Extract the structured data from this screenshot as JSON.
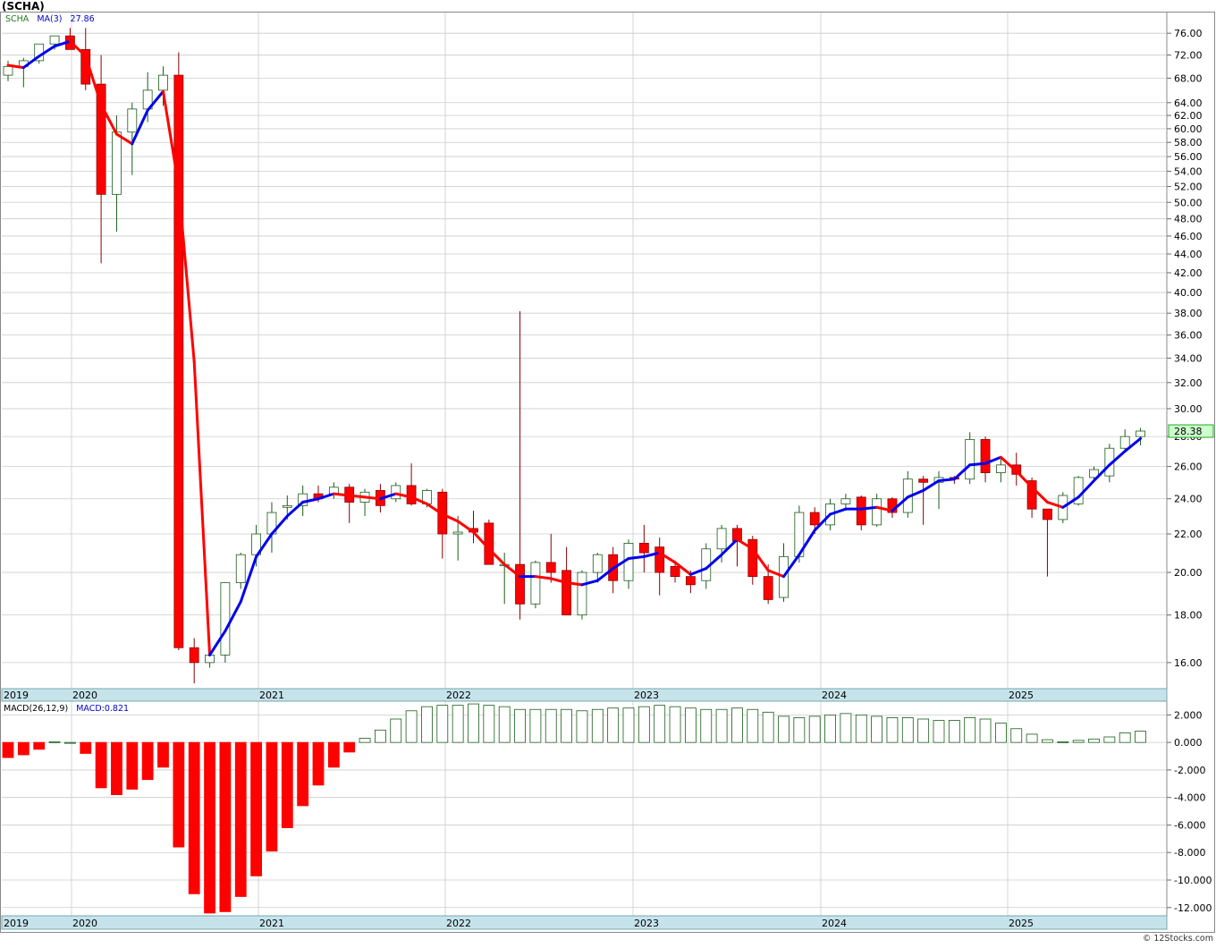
{
  "window": {
    "title": "(SCHA)",
    "footer": "© 12Stocks.com"
  },
  "legend": {
    "symbol": "SCHA",
    "ma_label": "MA(3)",
    "ma_value": "27.86",
    "macd_label": "MACD(26,12,9)",
    "macd_value": "MACD:0.821",
    "last_price": "28.38"
  },
  "colors": {
    "up_candle_fill": "#ffffff",
    "up_candle_border": "#1a5c1a",
    "down_candle": "#ff0000",
    "ma_up": "#0000ee",
    "ma_down": "#ff0000",
    "macd_pos": "#1a5c1a",
    "macd_neg": "#ff0000",
    "axis_band": "#c6e3ec",
    "grid": "#cccccc",
    "price_tag": "#ccffcc"
  },
  "chart_data": [
    {
      "type": "candlestick",
      "title": "(SCHA)",
      "scale": "log",
      "ylim": [
        15,
        80
      ],
      "y_ticks": [
        "16.00",
        "18.00",
        "20.00",
        "22.00",
        "24.00",
        "26.00",
        "28.00",
        "30.00",
        "32.00",
        "34.00",
        "36.00",
        "38.00",
        "40.00",
        "42.00",
        "44.00",
        "46.00",
        "48.00",
        "50.00",
        "52.00",
        "54.00",
        "56.00",
        "58.00",
        "60.00",
        "62.00",
        "64.00",
        "68.00",
        "72.00",
        "76.00"
      ],
      "x_ticks": [
        "2019",
        "2020",
        "2021",
        "2022",
        "2023",
        "2024",
        "2025"
      ],
      "grid": true,
      "periods": "monthly, 2019-08 to 2025-09",
      "ohlc": [
        [
          68.5,
          71.0,
          67.5,
          70.0
        ],
        [
          70.0,
          71.5,
          66.5,
          71.0
        ],
        [
          71.0,
          74.0,
          70.5,
          74.0
        ],
        [
          74.0,
          75.5,
          73.0,
          75.5
        ],
        [
          75.5,
          77.0,
          73.0,
          73.0
        ],
        [
          73.0,
          77.0,
          66.0,
          67.0
        ],
        [
          67.0,
          72.0,
          43.0,
          51.0
        ],
        [
          51.0,
          62.0,
          46.5,
          59.5
        ],
        [
          59.5,
          64.0,
          53.5,
          63.0
        ],
        [
          63.0,
          69.0,
          61.0,
          66.0
        ],
        [
          66.0,
          70.0,
          63.5,
          68.5
        ],
        [
          68.5,
          72.5,
          16.5,
          16.6
        ],
        [
          16.6,
          17.0,
          15.2,
          16.0
        ],
        [
          16.0,
          16.6,
          15.8,
          16.3
        ],
        [
          16.3,
          19.5,
          16.0,
          19.5
        ],
        [
          19.5,
          21.0,
          19.2,
          20.9
        ],
        [
          20.9,
          22.5,
          20.3,
          22.0
        ],
        [
          22.0,
          23.8,
          21.0,
          23.2
        ],
        [
          23.5,
          24.2,
          22.8,
          23.6
        ],
        [
          23.6,
          24.8,
          23.0,
          24.3
        ],
        [
          24.3,
          24.8,
          23.8,
          24.0
        ],
        [
          24.3,
          25.0,
          24.0,
          24.7
        ],
        [
          24.7,
          24.9,
          22.6,
          23.8
        ],
        [
          23.8,
          24.6,
          23.0,
          24.4
        ],
        [
          24.5,
          24.9,
          23.2,
          23.6
        ],
        [
          24.0,
          25.0,
          23.8,
          24.8
        ],
        [
          24.8,
          26.2,
          23.6,
          23.7
        ],
        [
          23.7,
          24.6,
          23.5,
          24.5
        ],
        [
          24.4,
          24.6,
          20.7,
          22.0
        ],
        [
          22.0,
          23.0,
          20.6,
          22.1
        ],
        [
          22.3,
          23.3,
          21.5,
          22.1
        ],
        [
          22.6,
          22.8,
          20.4,
          20.4
        ],
        [
          20.4,
          21.0,
          18.5,
          20.4
        ],
        [
          20.4,
          38.2,
          17.8,
          18.5
        ],
        [
          18.5,
          20.6,
          18.3,
          20.5
        ],
        [
          20.5,
          22.0,
          19.5,
          20.0
        ],
        [
          20.1,
          21.3,
          18.0,
          18.0
        ],
        [
          18.0,
          20.1,
          17.8,
          20.0
        ],
        [
          20.0,
          21.0,
          19.5,
          20.9
        ],
        [
          20.9,
          21.3,
          19.0,
          19.6
        ],
        [
          19.6,
          21.7,
          19.2,
          21.5
        ],
        [
          21.5,
          22.5,
          20.0,
          21.0
        ],
        [
          21.3,
          21.8,
          18.9,
          20.0
        ],
        [
          20.3,
          20.6,
          19.5,
          19.8
        ],
        [
          19.8,
          20.1,
          19.0,
          19.4
        ],
        [
          19.6,
          21.5,
          19.2,
          21.2
        ],
        [
          21.2,
          22.5,
          20.5,
          22.3
        ],
        [
          22.3,
          22.5,
          20.3,
          21.6
        ],
        [
          21.7,
          21.9,
          19.4,
          19.8
        ],
        [
          19.8,
          20.4,
          18.5,
          18.7
        ],
        [
          18.8,
          21.5,
          18.6,
          20.8
        ],
        [
          20.8,
          23.6,
          20.5,
          23.2
        ],
        [
          23.2,
          23.5,
          22.0,
          22.5
        ],
        [
          22.5,
          24.0,
          22.2,
          23.7
        ],
        [
          23.7,
          24.3,
          23.3,
          24.0
        ],
        [
          24.1,
          24.2,
          22.2,
          22.5
        ],
        [
          22.5,
          24.3,
          22.4,
          24.0
        ],
        [
          24.0,
          24.1,
          22.9,
          23.2
        ],
        [
          23.2,
          25.7,
          22.9,
          25.2
        ],
        [
          25.2,
          25.4,
          22.5,
          25.0
        ],
        [
          25.0,
          25.7,
          23.4,
          25.3
        ],
        [
          25.3,
          25.4,
          24.9,
          25.2
        ],
        [
          25.2,
          28.3,
          24.9,
          27.8
        ],
        [
          27.8,
          28.0,
          25.0,
          25.6
        ],
        [
          25.6,
          26.6,
          25.0,
          26.1
        ],
        [
          26.1,
          26.9,
          24.8,
          25.5
        ],
        [
          25.1,
          25.3,
          22.9,
          23.4
        ],
        [
          23.4,
          23.4,
          19.8,
          22.8
        ],
        [
          22.8,
          24.4,
          22.6,
          24.2
        ],
        [
          23.7,
          25.4,
          23.6,
          25.3
        ],
        [
          25.3,
          26.0,
          25.0,
          25.8
        ],
        [
          25.4,
          27.5,
          25.0,
          27.2
        ],
        [
          27.2,
          28.5,
          27.0,
          28.0
        ],
        [
          28.0,
          28.6,
          27.4,
          28.38
        ]
      ],
      "ma3": [
        70.2,
        69.8,
        71.8,
        73.6,
        74.5,
        71.8,
        63.7,
        59.2,
        57.8,
        62.8,
        65.8,
        52.0,
        33.7,
        16.3,
        17.3,
        18.6,
        20.8,
        22.0,
        23.0,
        23.8,
        24.0,
        24.3,
        24.2,
        24.1,
        24.0,
        24.3,
        24.1,
        23.7,
        23.1,
        22.7,
        22.1,
        21.2,
        20.4,
        19.8,
        19.8,
        19.7,
        19.5,
        19.4,
        19.6,
        20.2,
        20.7,
        20.8,
        21.0,
        20.5,
        19.9,
        20.2,
        20.9,
        21.7,
        21.2,
        20.1,
        19.8,
        20.9,
        22.2,
        23.1,
        23.4,
        23.4,
        23.5,
        23.3,
        24.1,
        24.5,
        25.1,
        25.2,
        26.1,
        26.2,
        26.6,
        25.7,
        24.7,
        23.8,
        23.5,
        24.1,
        25.1,
        26.1,
        27.0,
        27.86
      ]
    },
    {
      "type": "bar",
      "title": "MACD(26,12,9)",
      "ylim": [
        -12.6,
        3.0
      ],
      "y_ticks": [
        "2.000",
        "0.000",
        "-2.000",
        "-4.000",
        "-6.000",
        "-8.000",
        "-10.000",
        "-12.000"
      ],
      "x_ticks": [
        "2019",
        "2020",
        "2021",
        "2022",
        "2023",
        "2024",
        "2025"
      ],
      "values": [
        -1.1,
        -0.9,
        -0.5,
        0.05,
        0.0,
        -0.8,
        -3.3,
        -3.8,
        -3.4,
        -2.7,
        -1.8,
        -7.6,
        -11.0,
        -12.4,
        -12.3,
        -11.2,
        -9.7,
        -7.9,
        -6.2,
        -4.6,
        -3.1,
        -1.8,
        -0.7,
        0.3,
        0.9,
        1.7,
        2.3,
        2.6,
        2.7,
        2.7,
        2.8,
        2.7,
        2.6,
        2.4,
        2.4,
        2.4,
        2.4,
        2.3,
        2.4,
        2.5,
        2.5,
        2.6,
        2.7,
        2.6,
        2.5,
        2.4,
        2.4,
        2.5,
        2.4,
        2.2,
        1.9,
        1.8,
        1.9,
        2.0,
        2.1,
        2.0,
        1.9,
        1.8,
        1.8,
        1.7,
        1.6,
        1.6,
        1.8,
        1.7,
        1.4,
        1.0,
        0.6,
        0.2,
        0.05,
        0.15,
        0.25,
        0.4,
        0.7,
        0.82
      ]
    }
  ]
}
